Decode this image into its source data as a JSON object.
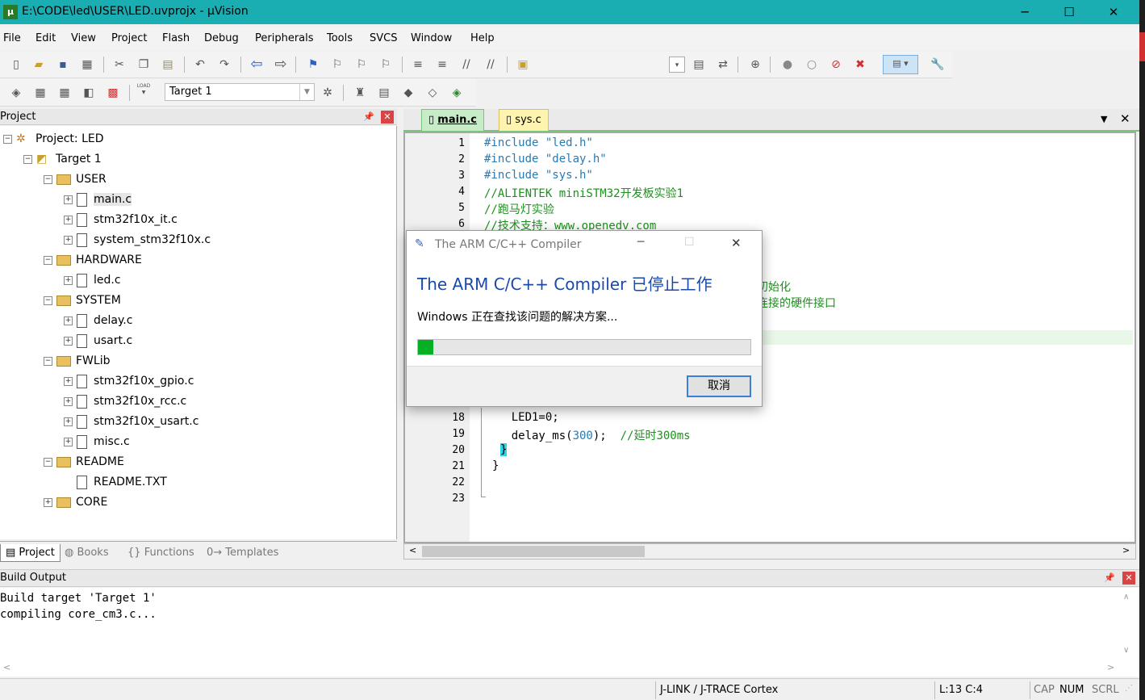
{
  "window": {
    "title": "E:\\CODE\\led\\USER\\LED.uvprojx - µVision",
    "app_icon": "µ",
    "minimize": "─",
    "maximize": "☐",
    "close": "✕"
  },
  "menu": [
    "File",
    "Edit",
    "View",
    "Project",
    "Flash",
    "Debug",
    "Peripherals",
    "Tools",
    "SVCS",
    "Window",
    "Help"
  ],
  "build_toolbar": {
    "target": "Target 1",
    "load_label": "LOAD"
  },
  "project_panel": {
    "title": "Project",
    "tree": [
      {
        "label": "Project: LED",
        "kind": "project",
        "expander": "⊟"
      },
      {
        "label": "Target 1",
        "kind": "target",
        "expander": "⊟"
      },
      {
        "label": "USER",
        "kind": "folder",
        "expander": "⊟"
      },
      {
        "label": "main.c",
        "kind": "file",
        "expander": "⊞",
        "selected": true
      },
      {
        "label": "stm32f10x_it.c",
        "kind": "file",
        "expander": "⊞"
      },
      {
        "label": "system_stm32f10x.c",
        "kind": "file",
        "expander": "⊞"
      },
      {
        "label": "HARDWARE",
        "kind": "folder",
        "expander": "⊟"
      },
      {
        "label": "led.c",
        "kind": "file",
        "expander": "⊞"
      },
      {
        "label": "SYSTEM",
        "kind": "folder",
        "expander": "⊟"
      },
      {
        "label": "delay.c",
        "kind": "file",
        "expander": "⊞"
      },
      {
        "label": "usart.c",
        "kind": "file",
        "expander": "⊞"
      },
      {
        "label": "FWLib",
        "kind": "folder",
        "expander": "⊟"
      },
      {
        "label": "stm32f10x_gpio.c",
        "kind": "file",
        "expander": "⊞"
      },
      {
        "label": "stm32f10x_rcc.c",
        "kind": "file",
        "expander": "⊞"
      },
      {
        "label": "stm32f10x_usart.c",
        "kind": "file",
        "expander": "⊞"
      },
      {
        "label": "misc.c",
        "kind": "file",
        "expander": "⊞"
      },
      {
        "label": "README",
        "kind": "folder",
        "expander": "⊟"
      },
      {
        "label": "README.TXT",
        "kind": "file",
        "expander": ""
      },
      {
        "label": "CORE",
        "kind": "folder",
        "expander": "⊞"
      }
    ],
    "tabs": [
      {
        "label": "Project"
      },
      {
        "label": "Books"
      },
      {
        "label": "Functions"
      },
      {
        "label": "Templates"
      }
    ]
  },
  "editor": {
    "tabs": [
      {
        "label": "main.c",
        "active": true
      },
      {
        "label": "sys.c",
        "active": false
      }
    ],
    "line_numbers_top": [
      "1",
      "2",
      "3",
      "4",
      "5",
      "6"
    ],
    "line_numbers_bottom": [
      "18",
      "19",
      "20",
      "21",
      "22",
      "23"
    ],
    "lines_top": [
      {
        "a": "#include ",
        "b": "\"led.h\""
      },
      {
        "a": "#include ",
        "b": "\"delay.h\""
      },
      {
        "a": "#include ",
        "b": "\"sys.h\""
      },
      {
        "c": "//ALIENTEK miniSTM32开发板实验1"
      },
      {
        "c": "//跑马灯实验"
      },
      {
        "c": "//技术支持：www.openedv.com"
      }
    ],
    "fragment_1": "初始化",
    "fragment_2": "连接的硬件接口",
    "line18": "    LED1=0;",
    "line19_code": "    delay_ms(",
    "line19_num": "300",
    "line19_rest": ");  ",
    "line19_comment": "//延时300ms",
    "line20": "}",
    "line21": "}"
  },
  "dialog": {
    "title": "The ARM C/C++ Compiler",
    "heading": "The ARM C/C++ Compiler 已停止工作",
    "message": "Windows 正在查找该问题的解决方案...",
    "progress": 0.045,
    "cancel": "取消",
    "minimize": "─",
    "maximize": "☐",
    "close": "✕"
  },
  "build_output": {
    "title": "Build Output",
    "lines": [
      "Build target 'Target 1'",
      "compiling core_cm3.c..."
    ]
  },
  "status": {
    "debugger": "J-LINK / J-TRACE Cortex",
    "position": "L:13 C:4",
    "cap": "CAP",
    "num": "NUM",
    "scrl": "SCRL"
  },
  "colors": {
    "titlebar": "#1aaeb2",
    "progress": "#06b025",
    "comment": "#1f8f1f",
    "preprocessor": "#2a7ab0"
  }
}
